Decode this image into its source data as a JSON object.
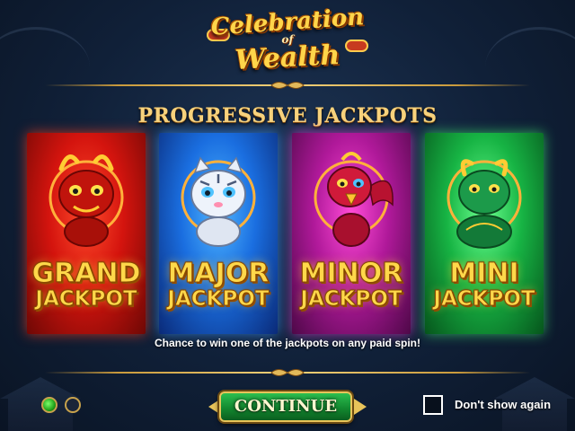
{
  "logo": {
    "line1": "Celebration",
    "line2": "of",
    "line3": "Wealth"
  },
  "title": "PROGRESSIVE JACKPOTS",
  "jackpots": [
    {
      "name": "GRAND",
      "word": "JACKPOT",
      "creature": "red-dragon-icon",
      "color": "#d4140e"
    },
    {
      "name": "MAJOR",
      "word": "JACKPOT",
      "creature": "white-tiger-icon",
      "color": "#1a6ee0"
    },
    {
      "name": "MINOR",
      "word": "JACKPOT",
      "creature": "phoenix-bird-icon",
      "color": "#b0199a"
    },
    {
      "name": "MINI",
      "word": "JACKPOT",
      "creature": "green-turtle-dragon-icon",
      "color": "#17b444"
    }
  ],
  "info_text": "Chance to win one of the jackpots on any paid spin!",
  "pagination": {
    "current": 1,
    "total": 2
  },
  "continue_label": "CONTINUE",
  "dont_show_label": "Don't show again",
  "colors": {
    "gold": "#f7d27c",
    "background": "#102038"
  }
}
